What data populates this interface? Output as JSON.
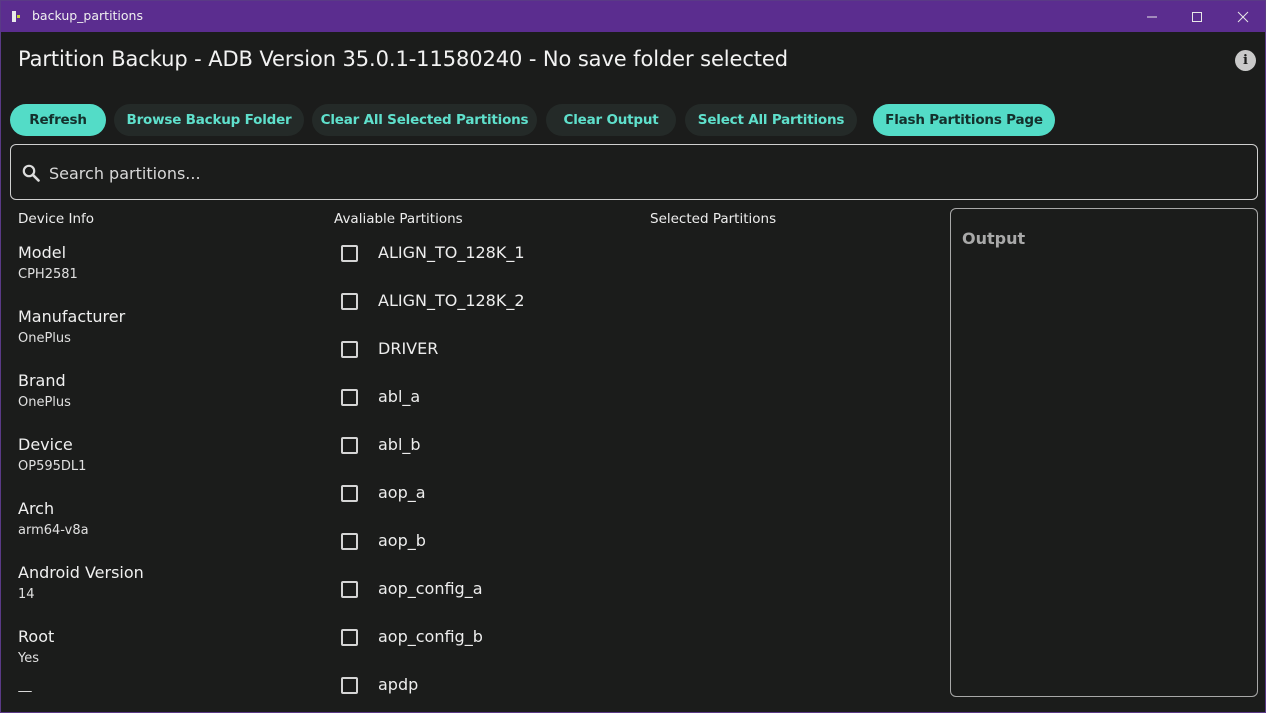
{
  "window": {
    "title": "backup_partitions",
    "controls": [
      "minimize-icon",
      "maximize-icon",
      "close-icon"
    ]
  },
  "header": {
    "title": "Partition Backup - ADB Version 35.0.1-11580240  - No save folder selected",
    "info_icon": "info-icon"
  },
  "toolbar": {
    "refresh": "Refresh",
    "browse": "Browse Backup Folder",
    "clear_selected": "Clear All Selected Partitions",
    "clear_output": "Clear Output",
    "select_all": "Select All Partitions",
    "flash_page": "Flash Partitions Page"
  },
  "search": {
    "placeholder": "Search partitions...",
    "value": ""
  },
  "device_info": {
    "title": "Device Info",
    "items": [
      {
        "label": "Model",
        "value": "CPH2581"
      },
      {
        "label": "Manufacturer",
        "value": "OnePlus"
      },
      {
        "label": "Brand",
        "value": "OnePlus"
      },
      {
        "label": "Device",
        "value": "OP595DL1"
      },
      {
        "label": "Arch",
        "value": "arm64-v8a"
      },
      {
        "label": "Android Version",
        "value": "14"
      },
      {
        "label": "Root",
        "value": "Yes"
      }
    ]
  },
  "available": {
    "title": "Avaliable Partitions",
    "partitions": [
      {
        "name": "ALIGN_TO_128K_1",
        "checked": false
      },
      {
        "name": "ALIGN_TO_128K_2",
        "checked": false
      },
      {
        "name": "DRIVER",
        "checked": false
      },
      {
        "name": "abl_a",
        "checked": false
      },
      {
        "name": "abl_b",
        "checked": false
      },
      {
        "name": "aop_a",
        "checked": false
      },
      {
        "name": "aop_b",
        "checked": false
      },
      {
        "name": "aop_config_a",
        "checked": false
      },
      {
        "name": "aop_config_b",
        "checked": false
      },
      {
        "name": "apdp",
        "checked": false
      }
    ]
  },
  "selected": {
    "title": "Selected Partitions"
  },
  "output": {
    "title": "Output"
  },
  "colors": {
    "background": "#1b1c1b",
    "titlebar": "#5b2d8f",
    "accent": "#53dcc7",
    "button_dark": "#242a28"
  }
}
